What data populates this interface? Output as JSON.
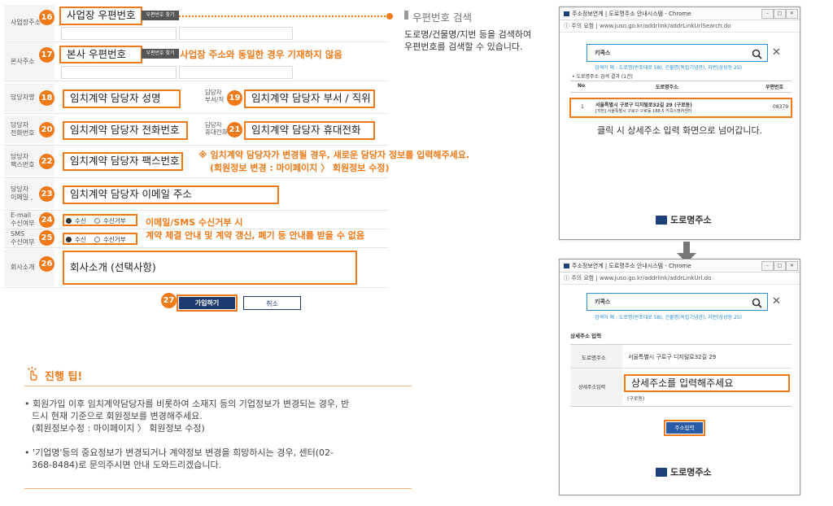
{
  "form": {
    "rows": [
      {
        "label": "사업장주소"
      },
      {
        "label": "본사주소"
      },
      {
        "label": "담당자명"
      },
      {
        "label": "담당자 전화번호"
      },
      {
        "label": "담당자 팩스번호"
      },
      {
        "label": "담당자 이메일"
      },
      {
        "label": "E-mail 수신여부"
      },
      {
        "label": "SMS 수신여부"
      },
      {
        "label": "회사소개"
      }
    ],
    "label_line1": {
      "contact_name": "담당자명",
      "dept_a": "담당자",
      "dept_b": "부서/직",
      "phone_a": "담당자",
      "phone_b": "전화번호",
      "mobile_a": "담당자",
      "mobile_b": "휴대전화",
      "fax_a": "담당자",
      "fax_b": "팩스번호",
      "email_a": "담당자",
      "email_b": "이메일 ,",
      "email_rcv_a": "E-mail",
      "email_rcv_b": "수신여부",
      "sms_a": "SMS",
      "sms_b": "수신여부",
      "intro": "회사소개",
      "biz_addr": "사업장주소",
      "hq_addr": "본사주소"
    },
    "badges": [
      "16",
      "17",
      "18",
      "19",
      "20",
      "21",
      "22",
      "23",
      "24",
      "25",
      "26",
      "27"
    ],
    "fields": {
      "biz_postcode": "사업장 우편번호",
      "hq_postcode": "본사 우편번호",
      "contact_name": "임치계약 담당자 성명",
      "contact_dept": "임치계약 담당자 부서 / 직위",
      "contact_phone": "임치계약 담당자 전화번호",
      "contact_mobile": "임치계약 담당자 휴대전화",
      "contact_fax": "임치계약 담당자 팩스번호",
      "contact_email": "임치계약 담당자 이메일 주소",
      "company_intro": "회사소개 (선택사항)"
    },
    "postcode_button": "우편번호 찾기",
    "hq_note": "사업장 주소와 동일한 경우 기재하지 않음",
    "change_note_1": "※ 임치계약 담당자가 변경될 경우, 새로운 담당자 정보를 입력해주세요.",
    "change_note_2": "(회원정보 변경 : 마이페이지 〉 회원정보 수정)",
    "radio_yes": "수신",
    "radio_no": "수신거부",
    "rcv_note_1": "이메일/SMS 수신거부 시",
    "rcv_note_2": "계약 체결 안내 및 계약 갱신, 폐기 등 안내를 받을 수 없음",
    "join_button": "가입하기",
    "cancel_button": "취소"
  },
  "postcode_info": {
    "title": "우편번호 검색",
    "desc_1": "도로명/건물명/지번 등을 검색하여",
    "desc_2": "우편번호를 검색할 수 있습니다."
  },
  "tips": {
    "title": "진행 팁!",
    "item1_l1": "• 회원가입 이후 임치계약담당자를 비롯하여 소재지 등의 기업정보가 변경되는 경우, 반",
    "item1_l2": "드시 현재 기준으로 회원정보를 변경해주세요.",
    "item1_l3": "(회원정보수정 : 마이페이지 〉 회원정보 수정)",
    "item2_l1": "• '기업명'등의 중요정보가 변경되거나 계약정보 변경을 희망하시는 경우, 센터(02-",
    "item2_l2": "368-8484)로 문의주시면 안내 도와드리겠습니다."
  },
  "popup1": {
    "title": "주소정보연계 | 도로명주소 안내시스템 - Chrome",
    "url": "ⓘ 주의 요함 | www.juso.go.kr/addrlink/addrLinkUrlSearch.do",
    "query": "키콕스",
    "example": "검색어 예 : 도로명(반포대로 58), 건물명(독립기념관), 지번(삼성동 25)",
    "result_count": "• 도로명주소 검색 결과 (1건)",
    "col_no": "No",
    "col_addr": "도로명주소",
    "col_zip": "우편번호",
    "row_no": "1",
    "row_addr": "서울특별시 구로구 디지털로32길 29 (구로동)",
    "row_jibun": "[지번] 서울특별시 구로구 구로동 188-5 키콕스벤처센터",
    "row_zip": "08379",
    "click_note": "클릭 시 상세주소 입력 화면으로 넘어갑니다.",
    "logo": "도로명주소"
  },
  "popup2": {
    "title": "주소정보연계 | 도로명주소 안내시스템 - Chrome",
    "url": "ⓘ 주의 요함 | www.juso.go.kr/addrlink/addrLinkUrl.do",
    "query": "키콕스",
    "example": "검색어 예 : 도로명(반포대로 58), 건물명(독립기념관), 지번(삼성동 25)",
    "section": "상세주소 입력",
    "road_label": "도로명주소",
    "road_value": "서울특별시 구로구 디지털로32길 29",
    "detail_label": "상세주소입력",
    "detail_value": "상세주소를 입력해주세요",
    "detail_sub": "(구로동)",
    "submit": "주소입력",
    "logo": "도로명주소"
  },
  "colors": {
    "accent": "#f07a1a",
    "blue": "#2a8fd6",
    "navy": "#1d3f7a"
  }
}
